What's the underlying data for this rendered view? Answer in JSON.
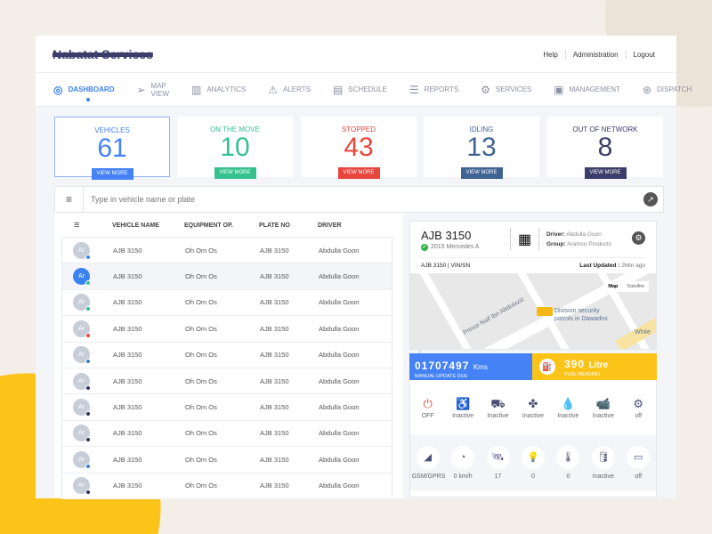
{
  "header": {
    "brand": "Nabatat Services",
    "links": [
      "Help",
      "Administration",
      "Logout"
    ]
  },
  "nav": [
    {
      "label": "DASHBOARD",
      "icon": "compass-icon",
      "glyph": "◎"
    },
    {
      "label": "MAP VIEW",
      "icon": "send-icon",
      "glyph": "➢"
    },
    {
      "label": "ANALYTICS",
      "icon": "bar-chart-icon",
      "glyph": "▥"
    },
    {
      "label": "ALERTS",
      "icon": "warning-icon",
      "glyph": "⚠"
    },
    {
      "label": "SCHEDULE",
      "icon": "calendar-icon",
      "glyph": "▤"
    },
    {
      "label": "REPORTS",
      "icon": "report-icon",
      "glyph": "☰"
    },
    {
      "label": "SERVICES",
      "icon": "gear-icon",
      "glyph": "⚙"
    },
    {
      "label": "MANAGEMENT",
      "icon": "briefcase-icon",
      "glyph": "▣"
    },
    {
      "label": "DISPATCH",
      "icon": "steering-wheel-icon",
      "glyph": "⊛"
    }
  ],
  "cards": [
    {
      "label": "VEHICLES",
      "value": "61",
      "color": "#4482f6",
      "btn": "VIEW MORE"
    },
    {
      "label": "ON THE MOVE",
      "value": "10",
      "color": "#35c18f",
      "btn": "VIEW MORE"
    },
    {
      "label": "STOPPED",
      "value": "43",
      "color": "#e8453c",
      "btn": "VIEW MORE"
    },
    {
      "label": "IDLING",
      "value": "13",
      "color": "#3f6494",
      "btn": "VIEW MORE"
    },
    {
      "label": "OUT OF NETWORK",
      "value": "8",
      "color": "#3b3d6b",
      "btn": "VIEW MORE"
    }
  ],
  "search": {
    "placeholder": "Type in vehicle name or plate"
  },
  "table": {
    "headers": [
      "VEHICLE NAME",
      "EQUIPMENT OP.",
      "PLATE NO",
      "DRIVER"
    ],
    "rows": [
      {
        "avatar": "Ar",
        "name": "AJB 3150",
        "equip": "Oh Om Os",
        "plate": "AJB 3150",
        "driver": "Abdulla Goon",
        "status": "#3b82f6"
      },
      {
        "avatar": "Ar",
        "name": "AJB 3150",
        "equip": "Oh Om Os",
        "plate": "AJB 3150",
        "driver": "Abdulla Goon",
        "status": "#35c18f"
      },
      {
        "avatar": "Ar",
        "name": "AJB 3150",
        "equip": "Oh Om Os",
        "plate": "AJB 3150",
        "driver": "Abdulla Goon",
        "status": "#35c18f"
      },
      {
        "avatar": "Ar",
        "name": "AJB 3150",
        "equip": "Oh Om Os",
        "plate": "AJB 3150",
        "driver": "Abdulla Goon",
        "status": "#e8453c"
      },
      {
        "avatar": "Ar",
        "name": "AJB 3150",
        "equip": "Oh Om Os",
        "plate": "AJB 3150",
        "driver": "Abdulla Goon",
        "status": "#3f7cc4"
      },
      {
        "avatar": "Ar",
        "name": "AJB 3150",
        "equip": "Oh Om Os",
        "plate": "AJB 3150",
        "driver": "Abdulla Goon",
        "status": "#2e3160"
      },
      {
        "avatar": "Ar",
        "name": "AJB 3150",
        "equip": "Oh Om Os",
        "plate": "AJB 3150",
        "driver": "Abdulla Goon",
        "status": "#2e3160"
      },
      {
        "avatar": "Ar",
        "name": "AJB 3150",
        "equip": "Oh Om Os",
        "plate": "AJB 3150",
        "driver": "Abdulla Goon",
        "status": "#2e3160"
      },
      {
        "avatar": "Ar",
        "name": "AJB 3150",
        "equip": "Oh Om Os",
        "plate": "AJB 3150",
        "driver": "Abdulla Goon",
        "status": "#3f7cc4"
      },
      {
        "avatar": "Ar",
        "name": "AJB 3150",
        "equip": "Oh Om Os",
        "plate": "AJB 3150",
        "driver": "Abdulla Goon",
        "status": "#2e3160"
      }
    ]
  },
  "detail": {
    "plate": "AJB 3150",
    "model": "2015 Mercedes A",
    "driver_label": "Driver:",
    "driver": "Abdulla Goon",
    "group_label": "Group:",
    "group": "Aramco Products",
    "vin": "AJB 3150  |  VIN/SN",
    "updated_label": "Last Updated :",
    "updated": "2Min ago",
    "map": {
      "street": "Prince Naif Ibn Abdulaziz",
      "poi": "Division security patrols in Dawadmi",
      "poi2": "White",
      "map_btn": "Map",
      "sat_btn": "Satellite"
    }
  },
  "odometer": {
    "value": "01707497",
    "unit": "Kms",
    "sub": "MANUAL UPDATE DUE"
  },
  "fuel": {
    "value": "390",
    "unit": "Litre",
    "sub": "FUEL READING"
  },
  "sensors1": [
    {
      "icon": "power-icon",
      "glyph": "⏻",
      "label": "OFF",
      "color": "#e8453c"
    },
    {
      "icon": "seatbelt-icon",
      "glyph": "♿",
      "label": "Inactive"
    },
    {
      "icon": "car-door-icon",
      "glyph": "⛟",
      "label": "Inactive"
    },
    {
      "icon": "fan-icon",
      "glyph": "✤",
      "label": "Inactive"
    },
    {
      "icon": "drop-icon",
      "glyph": "💧",
      "label": "Inactive"
    },
    {
      "icon": "camera-icon",
      "glyph": "📹",
      "label": "Inactive"
    },
    {
      "icon": "engine-icon",
      "glyph": "⚙",
      "label": "off"
    }
  ],
  "sensors2": [
    {
      "icon": "signal-icon",
      "glyph": "◢",
      "label": "GSM/GPRS"
    },
    {
      "icon": "speedometer-icon",
      "glyph": "◔",
      "label": "0 km/h"
    },
    {
      "icon": "satellite-icon",
      "glyph": "🛰",
      "label": "17"
    },
    {
      "icon": "bulb-icon",
      "glyph": "💡",
      "label": "0"
    },
    {
      "icon": "thermometer-icon",
      "glyph": "🌡",
      "label": "0"
    },
    {
      "icon": "oil-icon",
      "glyph": "🛢",
      "label": "Inactive"
    },
    {
      "icon": "battery-icon",
      "glyph": "▭",
      "label": "off"
    }
  ]
}
